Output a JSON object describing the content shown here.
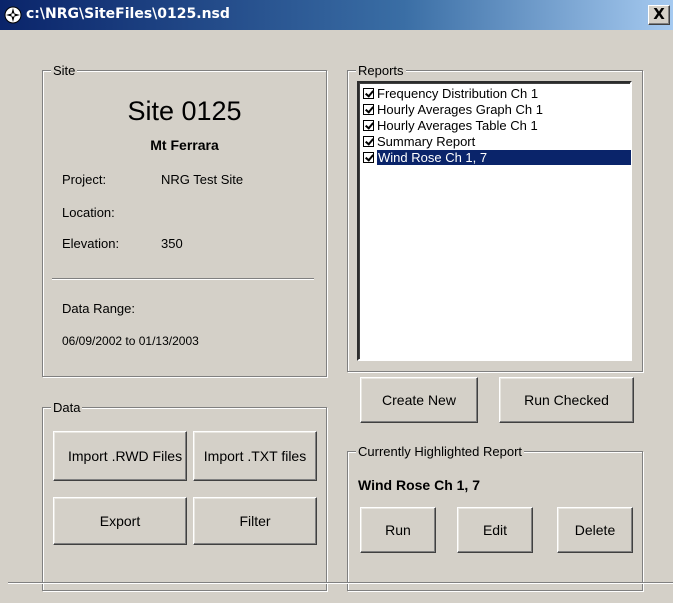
{
  "window": {
    "title": "c:\\NRG\\SiteFiles\\0125.nsd",
    "close_label": "X"
  },
  "site": {
    "legend": "Site",
    "heading": "Site 0125",
    "subheading": "Mt Ferrara",
    "project_label": "Project:",
    "project_value": "NRG Test Site",
    "location_label": "Location:",
    "location_value": "",
    "elevation_label": "Elevation:",
    "elevation_value": "350",
    "data_range_label": "Data Range:",
    "data_range_value": "06/09/2002 to 01/13/2003"
  },
  "data_group": {
    "legend": "Data",
    "import_rwd_label": "Import .RWD Files",
    "import_txt_label": "Import .TXT files",
    "export_label": "Export",
    "filter_label": "Filter"
  },
  "reports": {
    "legend": "Reports",
    "items": [
      {
        "label": "Frequency Distribution Ch 1",
        "checked": true,
        "selected": false
      },
      {
        "label": "Hourly Averages Graph Ch 1",
        "checked": true,
        "selected": false
      },
      {
        "label": "Hourly Averages Table Ch 1",
        "checked": true,
        "selected": false
      },
      {
        "label": "Summary Report",
        "checked": true,
        "selected": false
      },
      {
        "label": "Wind Rose Ch 1, 7",
        "checked": true,
        "selected": true
      }
    ],
    "create_new_label": "Create New",
    "run_checked_label": "Run Checked"
  },
  "highlighted": {
    "legend": "Currently Highlighted Report",
    "report_name": "Wind Rose Ch 1, 7",
    "run_label": "Run",
    "edit_label": "Edit",
    "delete_label": "Delete"
  },
  "colors": {
    "face": "#d4d0c8",
    "title_active": "#0a246a",
    "selection": "#0a246a"
  }
}
